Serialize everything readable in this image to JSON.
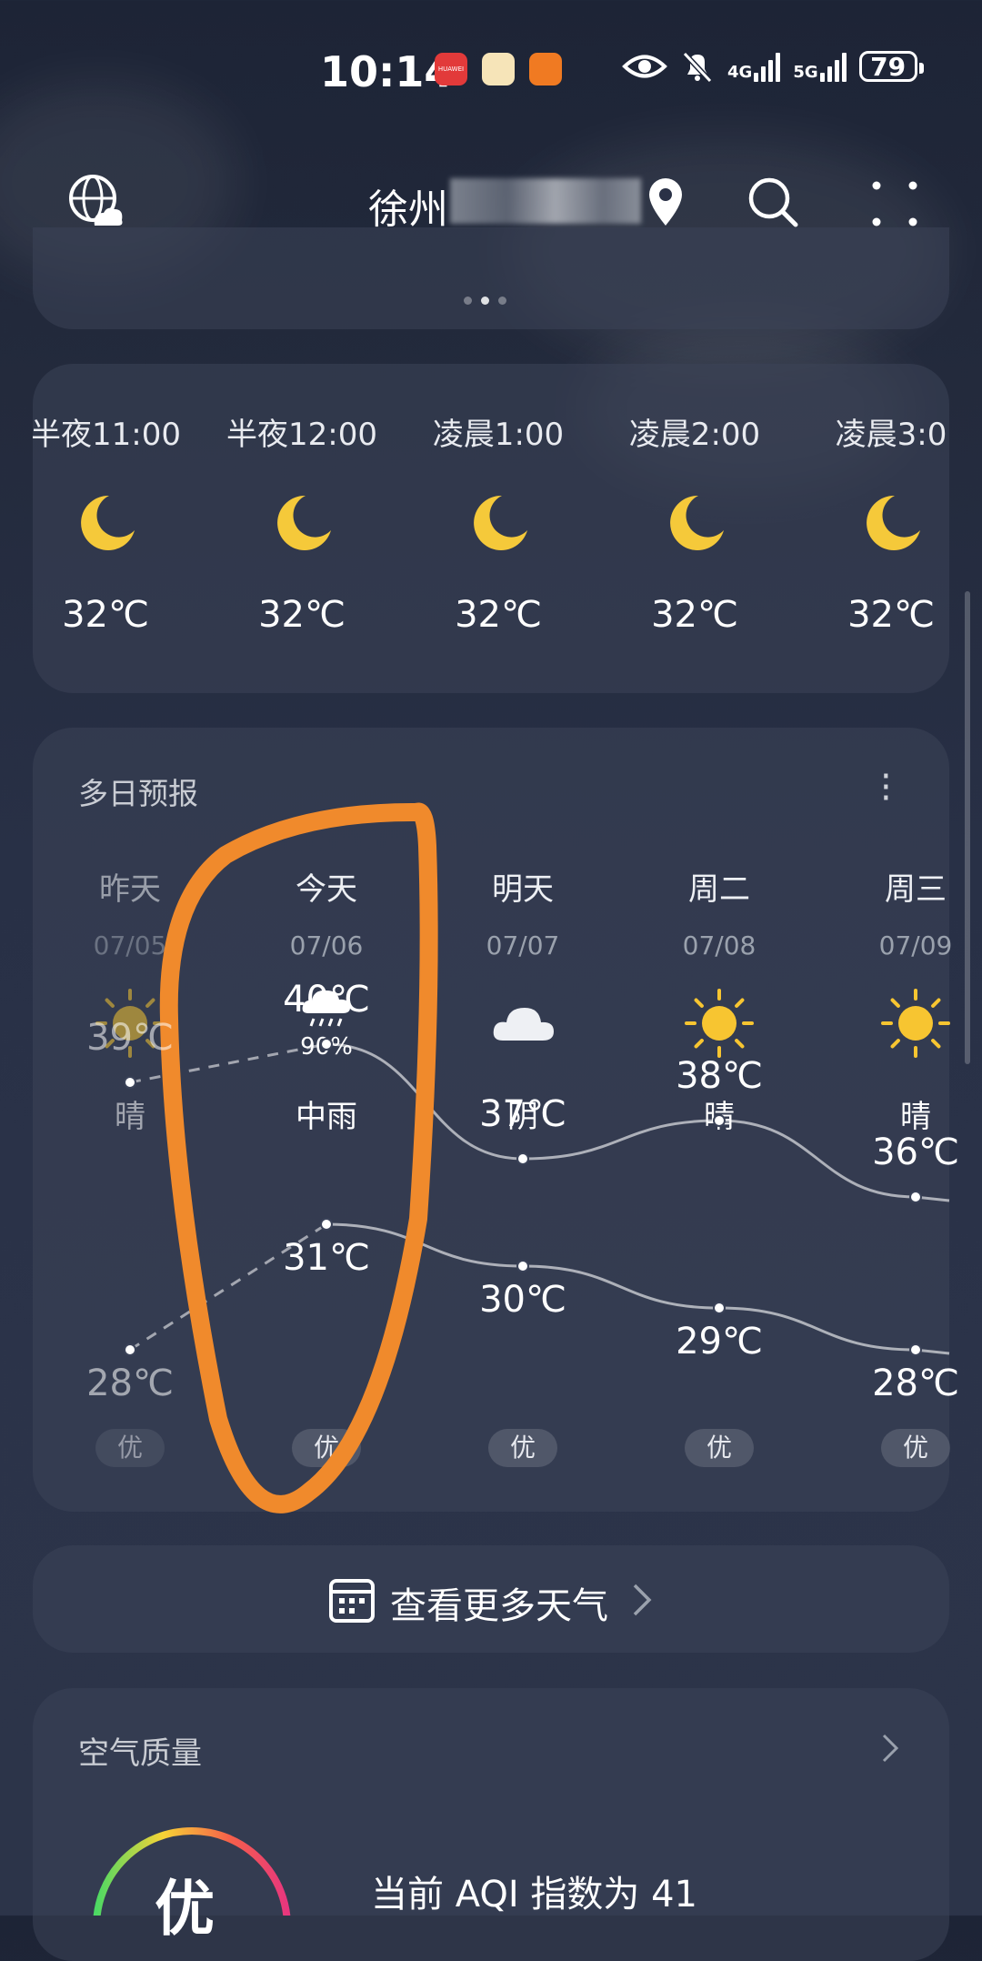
{
  "status_bar": {
    "time": "10:14",
    "battery": "79",
    "net1": "4G",
    "net2": "5G",
    "app_label": "HUAWEI"
  },
  "header": {
    "city": "徐州"
  },
  "hourly": [
    {
      "time": "半夜11:00",
      "temp": "32℃"
    },
    {
      "time": "半夜12:00",
      "temp": "32℃"
    },
    {
      "time": "凌晨1:00",
      "temp": "32℃"
    },
    {
      "time": "凌晨2:00",
      "temp": "32℃"
    },
    {
      "time": "凌晨3:0",
      "temp": "32℃"
    }
  ],
  "forecast": {
    "title": "多日预报",
    "days": [
      {
        "day": "昨天",
        "date": "07/05",
        "icon": "sun-icon",
        "condition": "晴",
        "high": "39℃",
        "low": "28℃",
        "aqi": "优",
        "rain_chance": ""
      },
      {
        "day": "今天",
        "date": "07/06",
        "icon": "rain-cloud-icon",
        "condition": "中雨",
        "high": "40℃",
        "low": "31℃",
        "aqi": "优",
        "rain_chance": "90%"
      },
      {
        "day": "明天",
        "date": "07/07",
        "icon": "cloud-icon",
        "condition": "阴",
        "high": "37℃",
        "low": "30℃",
        "aqi": "优",
        "rain_chance": ""
      },
      {
        "day": "周二",
        "date": "07/08",
        "icon": "sun-icon",
        "condition": "晴",
        "high": "38℃",
        "low": "29℃",
        "aqi": "优",
        "rain_chance": ""
      },
      {
        "day": "周三",
        "date": "07/09",
        "icon": "sun-icon",
        "condition": "晴",
        "high": "36℃",
        "low": "28℃",
        "aqi": "优",
        "rain_chance": ""
      }
    ],
    "high_values": [
      39,
      40,
      37,
      38,
      36
    ],
    "low_values": [
      28,
      31,
      30,
      29,
      28
    ]
  },
  "more_weather": {
    "label": "查看更多天气"
  },
  "air_quality": {
    "title": "空气质量",
    "level": "优",
    "summary": "当前 AQI 指数为 41"
  },
  "colors": {
    "sun": "#f7c531",
    "moon": "#f5c93a",
    "annotation": "#f08a2c"
  }
}
